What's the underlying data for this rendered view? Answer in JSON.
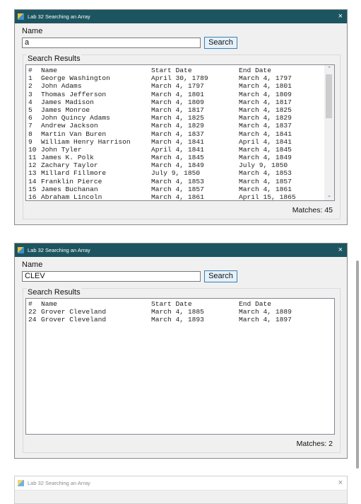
{
  "window_title": "Lab 32 Searching an Array",
  "name_label": "Name",
  "search_button": "Search",
  "group_label": "Search Results",
  "columns": {
    "num": "#",
    "name": "Name",
    "start": "Start Date",
    "end": "End Date"
  },
  "windows": [
    {
      "search_value": "a",
      "matches_label": "Matches: 45",
      "rows": [
        {
          "num": "1",
          "name": "George Washington",
          "start": "April 30, 1789",
          "end": "March 4, 1797"
        },
        {
          "num": "2",
          "name": "John Adams",
          "start": "March 4, 1797",
          "end": "March 4, 1801"
        },
        {
          "num": "3",
          "name": "Thomas Jefferson",
          "start": "March 4, 1801",
          "end": "March 4, 1809"
        },
        {
          "num": "4",
          "name": "James Madison",
          "start": "March 4, 1809",
          "end": "March 4, 1817"
        },
        {
          "num": "5",
          "name": "James Monroe",
          "start": "March 4, 1817",
          "end": "March 4, 1825"
        },
        {
          "num": "6",
          "name": "John Quincy Adams",
          "start": "March 4, 1825",
          "end": "March 4, 1829"
        },
        {
          "num": "7",
          "name": "Andrew Jackson",
          "start": "March 4, 1829",
          "end": "March 4, 1837"
        },
        {
          "num": "8",
          "name": "Martin Van Buren",
          "start": "March 4, 1837",
          "end": "March 4, 1841"
        },
        {
          "num": "9",
          "name": "William Henry Harrison",
          "start": "March 4, 1841",
          "end": "April 4, 1841"
        },
        {
          "num": "10",
          "name": "John Tyler",
          "start": "April 4, 1841",
          "end": "March 4, 1845"
        },
        {
          "num": "11",
          "name": "James K. Polk",
          "start": "March 4, 1845",
          "end": "March 4, 1849"
        },
        {
          "num": "12",
          "name": "Zachary Taylor",
          "start": "March 4, 1849",
          "end": "July 9, 1850"
        },
        {
          "num": "13",
          "name": "Millard Fillmore",
          "start": "July 9, 1850",
          "end": "March 4, 1853"
        },
        {
          "num": "14",
          "name": "Franklin Pierce",
          "start": "March 4, 1853",
          "end": "March 4, 1857"
        },
        {
          "num": "15",
          "name": "James Buchanan",
          "start": "March 4, 1857",
          "end": "March 4, 1861"
        },
        {
          "num": "16",
          "name": "Abraham Lincoln",
          "start": "March 4, 1861",
          "end": "April 15, 1865"
        }
      ]
    },
    {
      "search_value": "CLEV",
      "matches_label": "Matches: 2",
      "rows": [
        {
          "num": "22",
          "name": "Grover Cleveland",
          "start": "March 4, 1885",
          "end": "March 4, 1889"
        },
        {
          "num": "24",
          "name": "Grover Cleveland",
          "start": "March 4, 1893",
          "end": "March 4, 1897"
        }
      ]
    }
  ],
  "icons": {
    "app": "app-icon",
    "close": "×",
    "scroll_up": "⌃",
    "scroll_down": "⌄"
  }
}
